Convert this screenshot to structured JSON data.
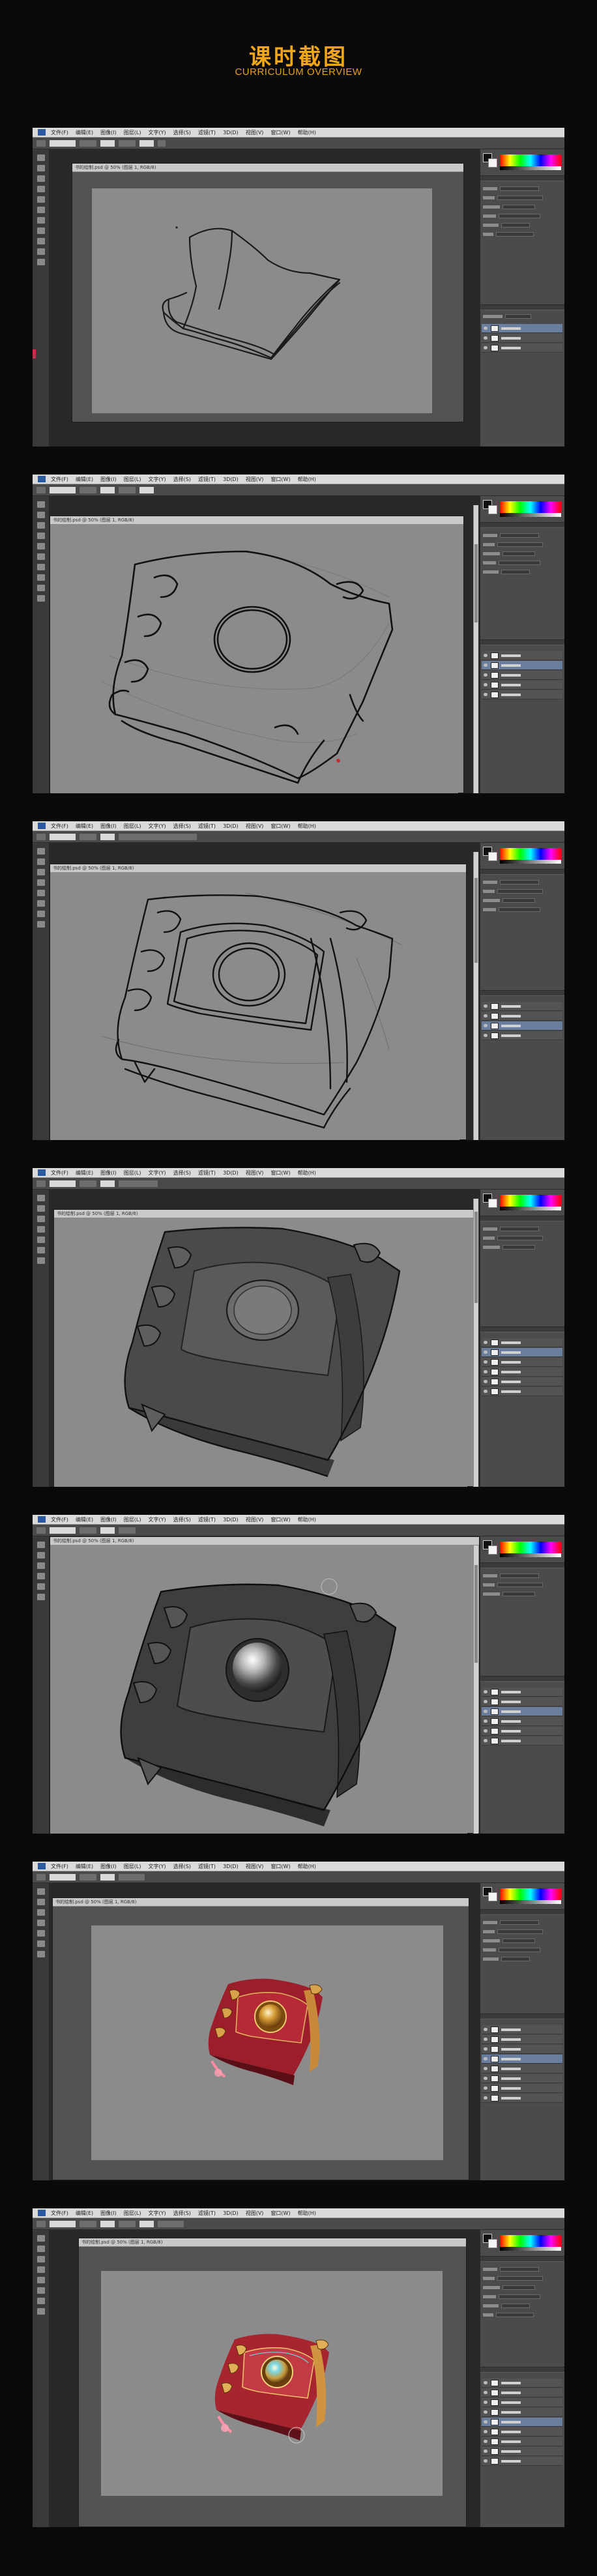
{
  "header": {
    "title": "课时截图",
    "subtitle": "CURRICULUM OVERVIEW"
  },
  "colors": {
    "page_background": "#0a0a0b",
    "title_accent": "#f0a51a",
    "workspace_gray": "#535353",
    "canvas_gray": "#8b8b8b",
    "book_red": "#9b1e2a",
    "gold": "#d8a24a"
  },
  "app": {
    "name": "Photoshop",
    "menu_items": [
      "文件(F)",
      "编辑(E)",
      "图像(I)",
      "图层(L)",
      "文字(Y)",
      "选择(S)",
      "滤镜(T)",
      "3D(D)",
      "视图(V)",
      "窗口(W)",
      "帮助(H)"
    ],
    "document_tab": "书的绘制.psd @ 50% (图层 1, RGB/8)"
  },
  "screenshots": [
    {
      "step": 1,
      "stage": "rough-sketch"
    },
    {
      "step": 2,
      "stage": "line-draft"
    },
    {
      "step": 3,
      "stage": "refined-lineart"
    },
    {
      "step": 4,
      "stage": "gray-blockin"
    },
    {
      "step": 5,
      "stage": "gray-shading"
    },
    {
      "step": 6,
      "stage": "color-render"
    },
    {
      "step": 7,
      "stage": "final-render"
    }
  ]
}
